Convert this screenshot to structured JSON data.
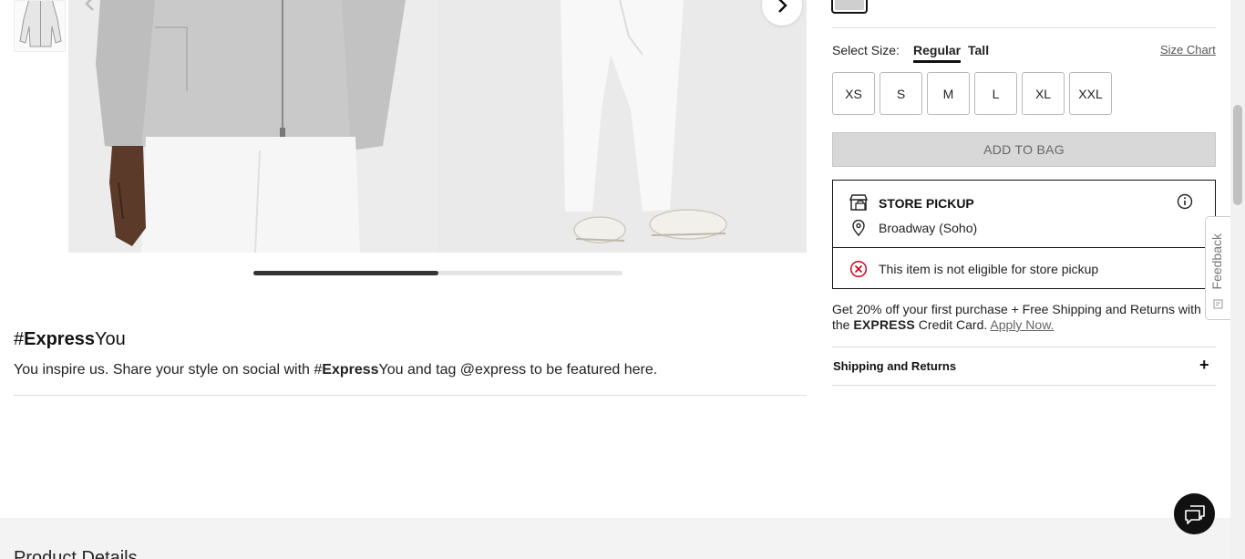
{
  "gallery": {
    "prev_icon": "chevron-left-icon",
    "next_icon": "chevron-right-icon",
    "progress": 0.5
  },
  "express": {
    "heading_prefix": "#",
    "heading_bold": "Express",
    "heading_suffix": "You",
    "desc_before": "You inspire us. Share your style on social with #",
    "desc_bold": "Express",
    "desc_after": "You and tag @express to be featured here."
  },
  "product_details": {
    "title": "Product Details"
  },
  "size": {
    "label": "Select Size:",
    "fits": [
      "Regular",
      "Tall"
    ],
    "active_fit": "Regular",
    "chart_link": "Size Chart",
    "options": [
      "XS",
      "S",
      "M",
      "L",
      "XL",
      "XXL"
    ]
  },
  "cart": {
    "add_to_bag": "ADD TO BAG"
  },
  "pickup": {
    "title": "STORE PICKUP",
    "store": "Broadway (Soho)",
    "ineligible": "This item is not eligible for store pickup"
  },
  "promo": {
    "text_before": "Get 20% off your first purchase + Free Shipping and Returns with the ",
    "brand": "EXPRESS",
    "text_after": " Credit Card. ",
    "link": "Apply Now."
  },
  "accordion": {
    "shipping_title": "Shipping and Returns",
    "toggle": "+"
  },
  "feedback": {
    "label": "Feedback"
  },
  "colors": {
    "accent": "#111111",
    "disabled_button": "#d8d8d8",
    "error": "#d0021b"
  }
}
